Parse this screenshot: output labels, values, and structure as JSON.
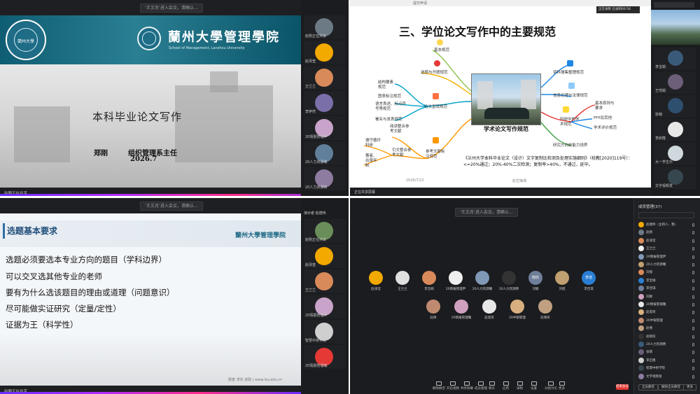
{
  "colors": {
    "teal_banner": "#0f5d72",
    "slide_heading_blue": "#1f4e79",
    "end_meeting_red": "#e53935",
    "live_bar_purple": "#8a2cff"
  },
  "q1": {
    "notice": "‘王文兆’进入会议，请确认…",
    "school_cn": "蘭州大學管理學院",
    "school_en": "School of Management, Lanzhou University",
    "seal_label": "蘭州大學",
    "title": "本科毕业论文写作",
    "author": "郑刚",
    "position": "组织管理系主任",
    "date": "2026.7",
    "bottom_label": "赵刚正在共享",
    "participants": [
      {
        "name": "赵刚正在共享",
        "color": "#6c7a86"
      },
      {
        "name": "赵泽莹",
        "color": "#f2a900"
      },
      {
        "name": "王兰兰",
        "color": "#d98a5a"
      },
      {
        "name": "李伊然",
        "color": "#7a6fa8"
      },
      {
        "name": "20情报管理尹",
        "color": "#c9a3c9"
      },
      {
        "name": "20人力资源曦",
        "color": "#5f7f9a"
      },
      {
        "name": "20人力资源韩",
        "color": "#8e7ca0"
      }
    ]
  },
  "q2": {
    "tab_text": "提交申请",
    "rec_text": "正在录制  已录制00:58",
    "title": "三、学位论文写作中的主要规范",
    "center_caption": "学术论文写作规范",
    "branches_left": [
      "基本规范",
      "选题与开题规范",
      "结构要素规范",
      "图表标注规范",
      "语言表述、标点符号等规范",
      "署名与发表规范",
      "论文呈现规范",
      "阅读整合参考文献",
      "遵守循环科研",
      "著者、出版年制",
      "引文整合参考文献",
      "参考文献标注规范"
    ],
    "branches_right": [
      "资料搜集整理规范",
      "信息伦理与法律规范",
      "基本原则与要求",
      "FFP及其他",
      "学术评价规范",
      "科研中的学术规范",
      "研究方向前能力培养"
    ],
    "regulation": "《兰州大学本科毕业论文（设计）文字复制比检测及处理实施细则》（校教[2020]119号）：<=20%通过；20%-40%二次检测；复制率>40%，不通过，延毕。",
    "footer_left": "2026/7/22",
    "footer_center": "赵芝梅课",
    "bottom_label": "正在共享屏幕",
    "rail_names": [
      "李宝娟",
      "王恺娟",
      "张萌",
      "李启隆",
      "大一学生乐",
      "文字视频发"
    ]
  },
  "q3": {
    "notice": "‘王文兆’进入会议，请确认…",
    "heading": "选题基本要求",
    "logo": "蘭州大學管理學院",
    "bullets": [
      "选题必须要选本专业方向的题目（学科边界）",
      "可以交叉选其他专业的老师",
      "要有为什么选该题目的理由或道理（问题意识）",
      "尽可能做实证研究（定量/定性）",
      "证据为王（科学性）"
    ],
    "footer": "勤奋 求实 进取 | www.lzu.edu.cn",
    "bottom_label": "赵刚正在共享",
    "rail_top": "演示者  赵德伟",
    "participants": [
      {
        "name": "赵刚正在共享",
        "color": "#6a8e5a"
      },
      {
        "name": "赵泽莹",
        "color": "#f2a900"
      },
      {
        "name": "王兰兰",
        "color": "#d98a5a"
      },
      {
        "name": "20情报管理尹",
        "color": "#c9a3c9"
      },
      {
        "name": "智慧中桥学院",
        "color": "#cfcfcf"
      },
      {
        "name": "20情报管理曦",
        "color": "#e53935"
      }
    ]
  },
  "q4": {
    "notice": "‘王文兆’进入会议，请确认…",
    "gallery_row1": [
      {
        "name": "赵泽莹",
        "color": "#f2a900"
      },
      {
        "name": "王兰兰",
        "color": "#e0e0e0"
      },
      {
        "name": "李宝娟",
        "color": "#d98a5a"
      },
      {
        "name": "20情报管理尹",
        "color": "#efefef"
      },
      {
        "name": "20人力资源曦",
        "color": "#7f98b5"
      },
      {
        "name": "20人力资源韩",
        "color": "#333"
      },
      {
        "name": "刘颖",
        "color": "#6f7f9a"
      },
      {
        "name": "刘旭",
        "color": "#c0a070"
      },
      {
        "name": "李佳琪",
        "color": "#2a7fd4"
      }
    ],
    "gallery_row2": [
      {
        "name": "赵倩",
        "color": "#c08a70"
      },
      {
        "name": "20情报管理曦",
        "color": "#d0a0c0"
      },
      {
        "name": "赵淑贤",
        "color": "#e8e8e8"
      },
      {
        "name": "20中银管理",
        "color": "#d8b080"
      },
      {
        "name": "赵晓彤",
        "color": "#c0a080"
      }
    ],
    "avatar_texts": [
      "晓欣",
      "李佳"
    ],
    "toolbar": [
      "解除静音",
      "开启视频",
      "共享屏幕",
      "成员管理",
      "聊天",
      "应用",
      "录制",
      "设置",
      "分组讨论",
      "更多"
    ],
    "end_label": "结束会议",
    "panel_title": "成员管理(37)",
    "panel_rows": [
      "赵德伟（主持人、我）",
      "赵刚",
      "赵泽莹",
      "王兰兰",
      "20情报管理尹",
      "20人力资源曦",
      "刘旭",
      "李宝娟",
      "李佳琪",
      "刘颖",
      "20情报管理曦",
      "赵淑贤",
      "20中银管理",
      "赵倩",
      "赵晓彤",
      "20人力资源韩",
      "张萌",
      "李启隆",
      "智慧中桥学院",
      "文字视频发"
    ],
    "panel_buttons": [
      "全员静音",
      "解除全员静音",
      "更多"
    ]
  }
}
